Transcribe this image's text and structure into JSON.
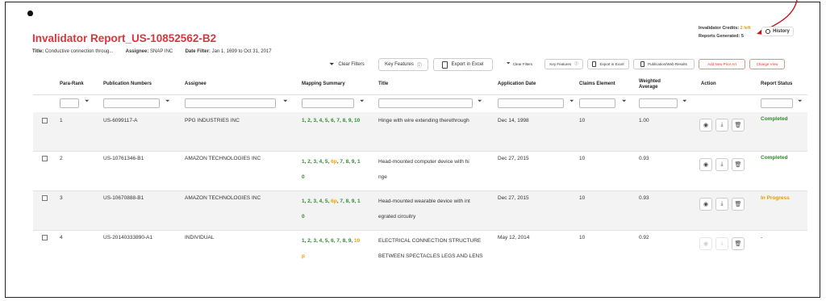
{
  "report": {
    "title": "Invalidator Report_US-10852562-B2",
    "meta_title_label": "Title:",
    "meta_title_value": "Conductive connection throug...",
    "meta_assignee_label": "Assignee:",
    "meta_assignee_value": "SNAP INC",
    "meta_date_label": "Date Filter:",
    "meta_date_value": "Jan 1, 1699 to Oct 31, 2017"
  },
  "credits": {
    "label": "Invalidator Credits:",
    "value": "2 left",
    "generated_label": "Reports Generated:",
    "generated_value": "5",
    "history_label": "History"
  },
  "toolbar_main": {
    "clear_filters": "Clear Filters",
    "key_features": "Key Features",
    "export_excel": "Export in Excel"
  },
  "toolbar_small": {
    "clear_filters": "Clear Filters",
    "key_features": "Key Features",
    "export_excel": "Export in Excel",
    "publication_results": "Publication/Web Results",
    "add_prior_art": "Add New Prior Art",
    "change_view": "Change View"
  },
  "columns": {
    "para_rank": "Para-Rank",
    "publication_numbers": "Publication Numbers",
    "assignee": "Assignee",
    "mapping_summary": "Mapping Summary",
    "title": "Title",
    "application_date": "Application Date",
    "claims_element": "Claims Element",
    "weighted_average": "Weighted Average",
    "action": "Action",
    "report_status": "Report Status"
  },
  "rows": [
    {
      "rank": "1",
      "publication": "US-6099117-A",
      "assignee": "PPG INDUSTRIES INC",
      "mapping_line1": "1, 2, 3, 4, 5, 6, 7, 8, 9, 10",
      "mapping_line2": "",
      "title_line1": "Hinge with wire extending therethrough",
      "title_line2": "",
      "date": "Dec 14, 1998",
      "claims": "10",
      "weighted": "1.00",
      "status": "Completed"
    },
    {
      "rank": "2",
      "publication": "US-10761346-B1",
      "assignee": "AMAZON TECHNOLOGIES INC",
      "mapping_line1_green": "1, 2, 3, 4, 5, ",
      "mapping_line1_orange": "6p",
      "mapping_line1_rest": ", 7, 8, 9, 1",
      "mapping_line2": "0",
      "title_line1": "Head-mounted computer device with hi",
      "title_line2": "nge",
      "date": "Dec 27, 2015",
      "claims": "10",
      "weighted": "0.93",
      "status": "Completed"
    },
    {
      "rank": "3",
      "publication": "US-10670888-B1",
      "assignee": "AMAZON TECHNOLOGIES INC",
      "mapping_line1_green": "1, 2, 3, 4, 5, ",
      "mapping_line1_orange": "6p",
      "mapping_line1_rest": ", 7, 8, 9, 1",
      "mapping_line2": "0",
      "title_line1": "Head-mounted wearable device with int",
      "title_line2": "egrated circuitry",
      "date": "Dec 27, 2015",
      "claims": "10",
      "weighted": "0.93",
      "status": "In Progress"
    },
    {
      "rank": "4",
      "publication": "US-20140333890-A1",
      "assignee": "INDIVIDUAL",
      "mapping_line1_green": "1, 2, 3, 4, 5, 6, 7, 8, 9, ",
      "mapping_line1_orange": "10",
      "mapping_line2": "p",
      "title_line1": "ELECTRICAL CONNECTION STRUCTURE",
      "title_line2": "BETWEEN SPECTACLES LEGS AND LENS",
      "date": "May 12, 2014",
      "claims": "10",
      "weighted": "0.92",
      "status": "-"
    }
  ],
  "colors": {
    "title_red": "#d9363e",
    "status_green": "#2e8b2e",
    "status_orange": "#e89a00"
  }
}
